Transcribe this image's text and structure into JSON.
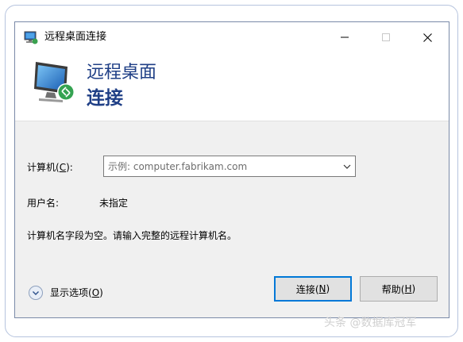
{
  "window": {
    "title": "远程桌面连接",
    "buttons": {
      "minimize": "minimize-icon",
      "maximize": "maximize-icon",
      "close": "close-icon"
    }
  },
  "banner": {
    "line1": "远程桌面",
    "line2": "连接"
  },
  "form": {
    "computer_label": "计算机(",
    "computer_accel": "C",
    "computer_label_end": "):",
    "computer_placeholder": "示例: computer.fabrikam.com",
    "username_label": "用户名:",
    "username_value": "未指定",
    "message": "计算机名字段为空。请输入完整的远程计算机名。"
  },
  "footer": {
    "options_label": "显示选项(",
    "options_accel": "O",
    "options_label_end": ")",
    "connect_label": "连接(",
    "connect_accel": "N",
    "connect_label_end": ")",
    "help_label": "帮助(",
    "help_accel": "H",
    "help_label_end": ")"
  },
  "watermark": "头条 @数据库冠军",
  "colors": {
    "banner_text": "#1f3f86",
    "primary_button_border": "#0078d7",
    "dialog_background": "#f0f0f0"
  }
}
